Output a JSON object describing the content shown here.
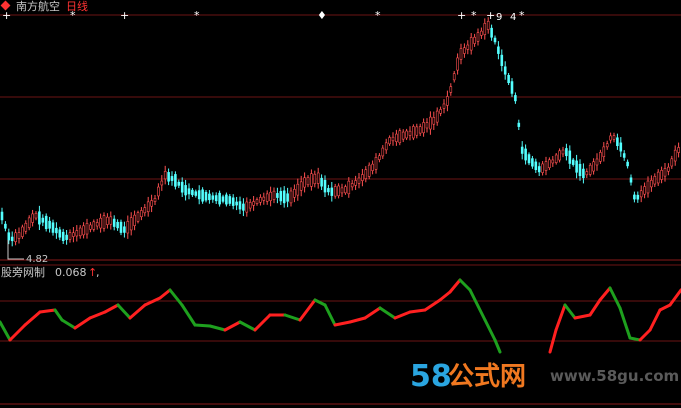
{
  "header": {
    "logo_icon": "stock-diamond-icon",
    "stock_name": "南方航空",
    "period": "日线",
    "stock_color": "#c8c8c8",
    "period_color": "#ff3333"
  },
  "price_chart": {
    "low_label": "4.82",
    "peak_markers": [
      "9",
      "4"
    ],
    "colors": {
      "up": "#ff5050",
      "down": "#54ffff",
      "grid": "#6b1414"
    }
  },
  "indicator": {
    "name": "股旁网制",
    "value": "0.068",
    "arrow": "↑",
    "suffix": ",",
    "colors": {
      "up": "#ff2020",
      "down": "#1ea01e"
    }
  },
  "watermark": {
    "brand_number": "58",
    "brand_text": "公式网",
    "site": "www.58gu.com"
  }
}
